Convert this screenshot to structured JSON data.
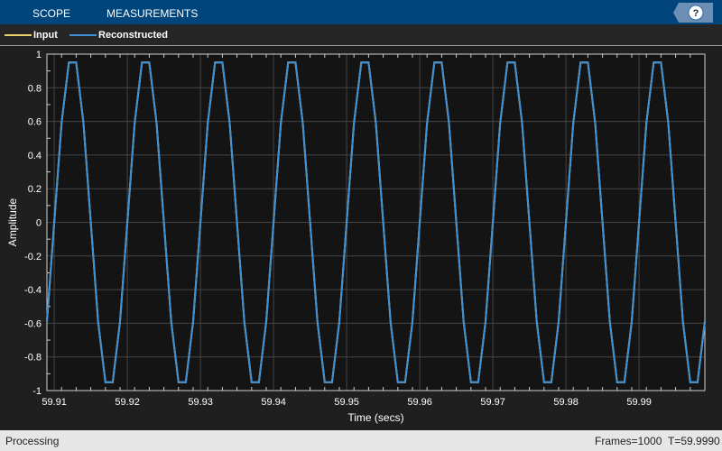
{
  "toolbar": {
    "tabs": [
      {
        "label": "SCOPE"
      },
      {
        "label": "MEASUREMENTS"
      }
    ],
    "help_label": "?"
  },
  "legend": [
    {
      "label": "Input",
      "color": "#e6d16b"
    },
    {
      "label": "Reconstructed",
      "color": "#3e8fd6"
    }
  ],
  "status": {
    "left": "Processing",
    "frames": "Frames=1000",
    "time": "T=59.9990"
  },
  "chart_data": {
    "type": "line",
    "title": "",
    "xlabel": "Time (secs)",
    "ylabel": "Amplitude",
    "xlim": [
      59.909,
      59.999
    ],
    "ylim": [
      -1,
      1
    ],
    "grid": true,
    "legend_placement": "top-left",
    "xticks": [
      "59.91",
      "59.92",
      "59.93",
      "59.94",
      "59.95",
      "59.96",
      "59.97",
      "59.98",
      "59.99"
    ],
    "yticks": [
      "-1",
      "-0.8",
      "-0.6",
      "-0.4",
      "-0.2",
      "0",
      "0.2",
      "0.4",
      "0.6",
      "0.8",
      "1"
    ],
    "x_start": 59.909,
    "x_step": 0.001,
    "series": [
      {
        "name": "Input",
        "color": "#e6d16b",
        "values": [
          -0.59,
          0,
          0.59,
          0.95,
          0.95,
          0.59,
          0,
          -0.59,
          -0.95,
          -0.95,
          -0.59,
          0,
          0.59,
          0.95,
          0.95,
          0.59,
          0,
          -0.59,
          -0.95,
          -0.95,
          -0.59,
          0,
          0.59,
          0.95,
          0.95,
          0.59,
          0,
          -0.59,
          -0.95,
          -0.95,
          -0.59,
          0,
          0.59,
          0.95,
          0.95,
          0.59,
          0,
          -0.59,
          -0.95,
          -0.95,
          -0.59,
          0,
          0.59,
          0.95,
          0.95,
          0.59,
          0,
          -0.59,
          -0.95,
          -0.95,
          -0.59,
          0,
          0.59,
          0.95,
          0.95,
          0.59,
          0,
          -0.59,
          -0.95,
          -0.95,
          -0.59,
          0,
          0.59,
          0.95,
          0.95,
          0.59,
          0,
          -0.59,
          -0.95,
          -0.95,
          -0.59,
          0,
          0.59,
          0.95,
          0.95,
          0.59,
          0,
          -0.59,
          -0.95,
          -0.95,
          -0.59,
          0,
          0.59,
          0.95,
          0.95,
          0.59,
          0,
          -0.59,
          -0.95,
          -0.95,
          -0.59
        ]
      },
      {
        "name": "Reconstructed",
        "color": "#3e8fd6",
        "values": [
          -0.59,
          0,
          0.59,
          0.95,
          0.95,
          0.59,
          0,
          -0.59,
          -0.95,
          -0.95,
          -0.59,
          0,
          0.59,
          0.95,
          0.95,
          0.59,
          0,
          -0.59,
          -0.95,
          -0.95,
          -0.59,
          0,
          0.59,
          0.95,
          0.95,
          0.59,
          0,
          -0.59,
          -0.95,
          -0.95,
          -0.59,
          0,
          0.59,
          0.95,
          0.95,
          0.59,
          0,
          -0.59,
          -0.95,
          -0.95,
          -0.59,
          0,
          0.59,
          0.95,
          0.95,
          0.59,
          0,
          -0.59,
          -0.95,
          -0.95,
          -0.59,
          0,
          0.59,
          0.95,
          0.95,
          0.59,
          0,
          -0.59,
          -0.95,
          -0.95,
          -0.59,
          0,
          0.59,
          0.95,
          0.95,
          0.59,
          0,
          -0.59,
          -0.95,
          -0.95,
          -0.59,
          0,
          0.59,
          0.95,
          0.95,
          0.59,
          0,
          -0.59,
          -0.95,
          -0.95,
          -0.59,
          0,
          0.59,
          0.95,
          0.95,
          0.59,
          0,
          -0.59,
          -0.95,
          -0.95,
          -0.59
        ]
      }
    ]
  }
}
